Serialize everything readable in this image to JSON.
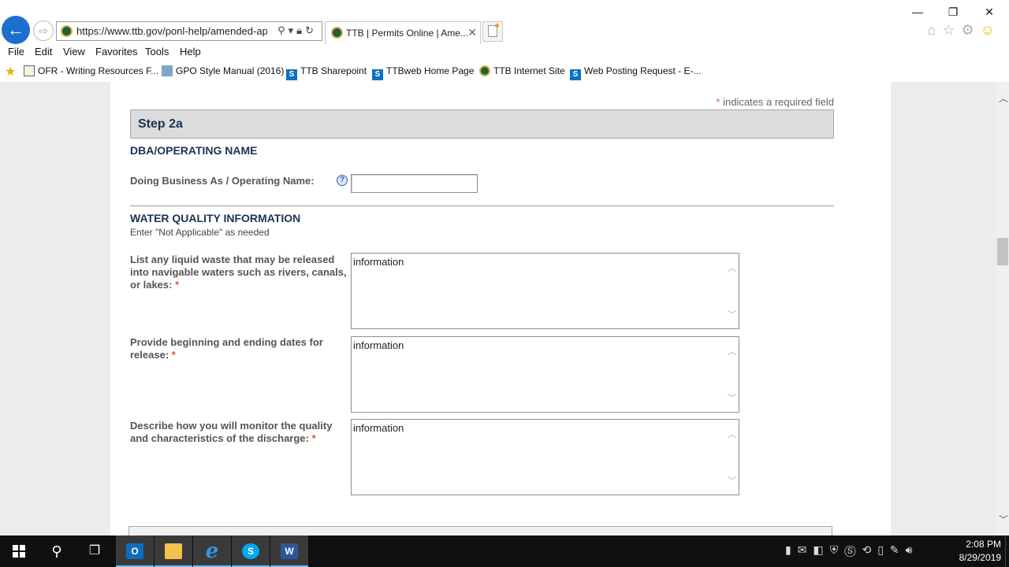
{
  "browser": {
    "url": "https://www.ttb.gov/ponl-help/amended-app",
    "tab_title": "TTB | Permits Online | Ame...",
    "tab_close": "✕",
    "window_controls": [
      "—",
      "❐",
      "✕"
    ],
    "menu": [
      "File",
      "Edit",
      "View",
      "Favorites",
      "Tools",
      "Help"
    ],
    "favorites": [
      {
        "label": "OFR - Writing Resources F...",
        "icon": "document-icon"
      },
      {
        "label": "GPO Style Manual (2016)",
        "icon": "gpo-icon"
      },
      {
        "label": "TTB Sharepoint",
        "icon": "sharepoint-icon"
      },
      {
        "label": "TTBweb Home Page",
        "icon": "sharepoint-icon"
      },
      {
        "label": "TTB Internet Site",
        "icon": "ttb-seal-icon"
      },
      {
        "label": "Web Posting Request - E-...",
        "icon": "sharepoint-icon"
      }
    ]
  },
  "form": {
    "required_star": "*",
    "required_note": "indicates a required field",
    "step_title": "Step 2a",
    "dba_section": "DBA/OPERATING NAME",
    "dba_label": "Doing Business As / Operating Name:",
    "dba_value": "",
    "help_glyph": "?",
    "water_section": "WATER QUALITY INFORMATION",
    "water_sub": "Enter \"Not Applicable\" as needed",
    "fields": [
      {
        "label": "List any liquid waste that may be released into navigable waters such as rivers, canals, or lakes:",
        "value": "information"
      },
      {
        "label": "Provide beginning and ending dates for release:",
        "value": "information"
      },
      {
        "label": "Describe how you will monitor the quality and characteristics of the discharge:",
        "value": "information"
      }
    ]
  },
  "taskbar": {
    "time": "2:08 PM",
    "date": "8/29/2019",
    "apps": [
      {
        "name": "outlook",
        "glyph": "O"
      },
      {
        "name": "file-explorer",
        "glyph": ""
      },
      {
        "name": "internet-explorer",
        "glyph": "e"
      },
      {
        "name": "skype",
        "glyph": "S"
      },
      {
        "name": "word",
        "glyph": "W"
      }
    ]
  }
}
